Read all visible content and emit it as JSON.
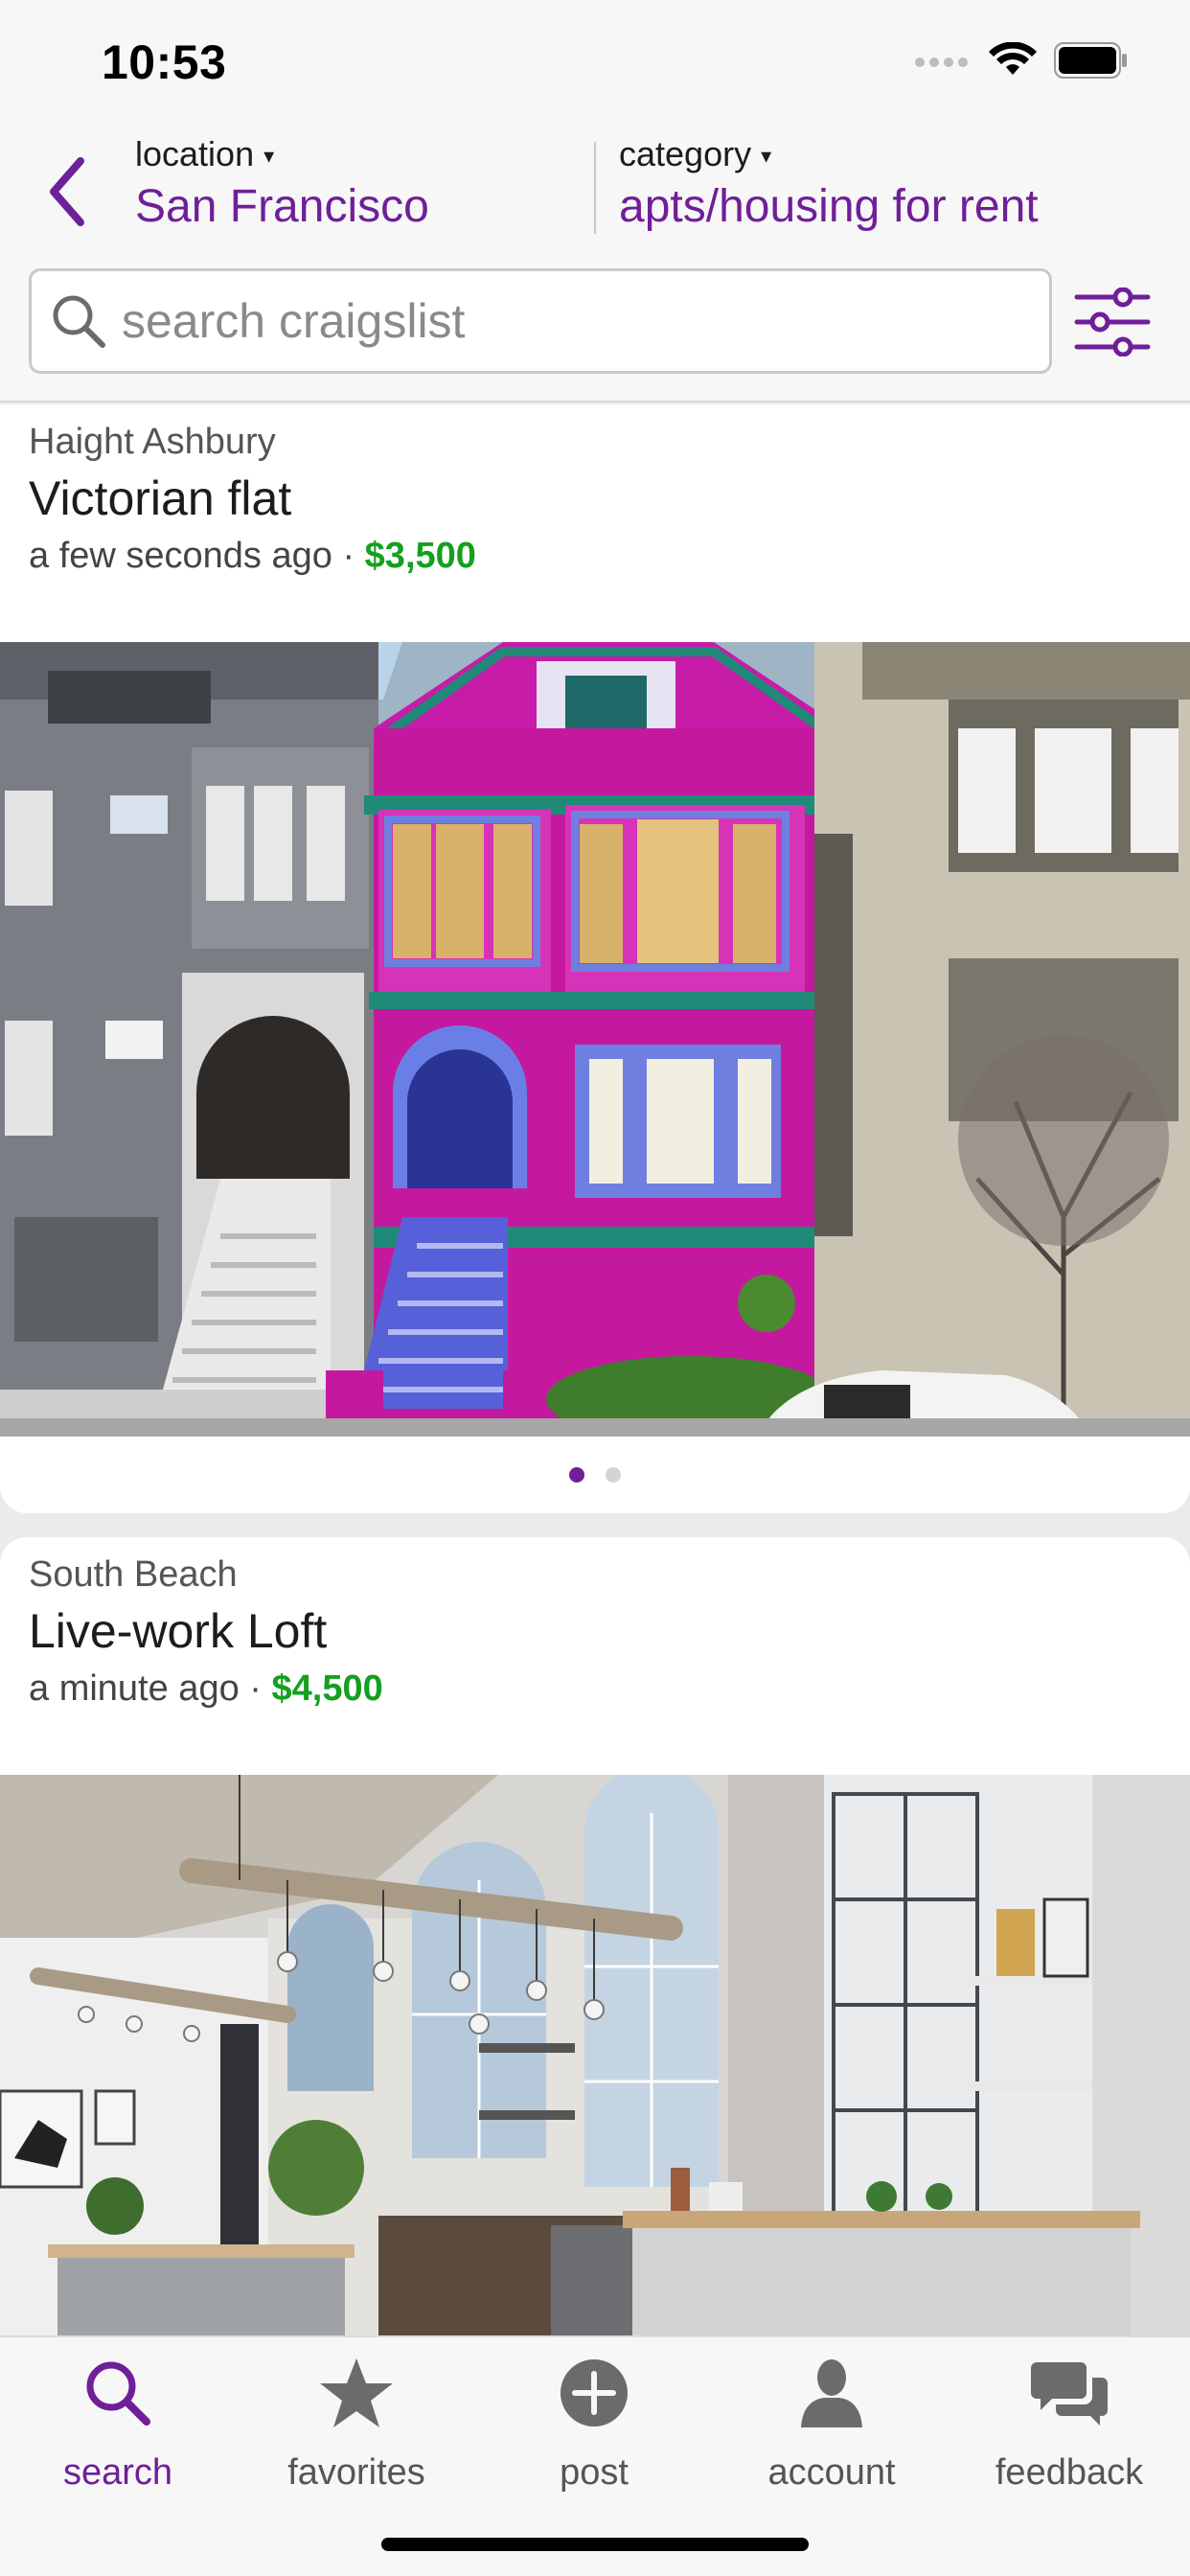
{
  "status_bar": {
    "time": "10:53"
  },
  "header": {
    "location_label": "location",
    "location_value": "San Francisco",
    "category_label": "category",
    "category_value": "apts/housing for rent",
    "caret": "▾"
  },
  "search": {
    "placeholder": "search craigslist",
    "value": ""
  },
  "listings": [
    {
      "neighborhood": "Haight Ashbury",
      "title": "Victorian flat",
      "posted": "a few seconds ago",
      "separator": "·",
      "price": "$3,500"
    },
    {
      "neighborhood": "South Beach",
      "title": "Live-work Loft",
      "posted": "a minute ago",
      "separator": "·",
      "price": "$4,500"
    }
  ],
  "tabs": [
    {
      "label": "search",
      "icon": "search-icon",
      "active": true
    },
    {
      "label": "favorites",
      "icon": "star-icon",
      "active": false
    },
    {
      "label": "post",
      "icon": "plus-circle-icon",
      "active": false
    },
    {
      "label": "account",
      "icon": "person-icon",
      "active": false
    },
    {
      "label": "feedback",
      "icon": "chat-bubbles-icon",
      "active": false
    }
  ],
  "colors": {
    "accent": "#6f1f99",
    "price": "#14a01f",
    "header_bg": "#f7f7f7",
    "page_bg": "#ebebeb"
  }
}
